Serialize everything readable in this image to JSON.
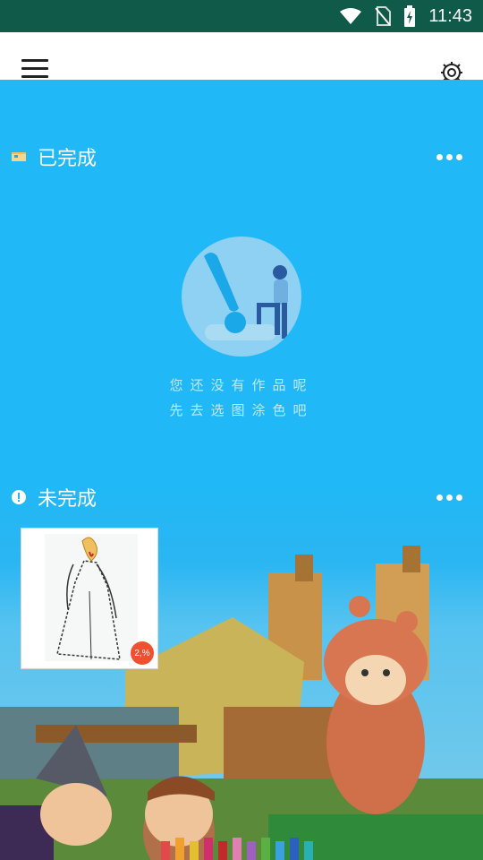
{
  "status_bar": {
    "time": "11:43",
    "icons": [
      "wifi-icon",
      "no-sim-icon",
      "battery-charging-icon"
    ]
  },
  "toolbar": {
    "left_icon": "menu-icon",
    "right_icon": "settings-icon"
  },
  "sections": {
    "completed": {
      "title": "已完成",
      "icon": "folder-icon",
      "more_icon": "more-horizontal-icon"
    },
    "incomplete": {
      "title": "未完成",
      "icon": "alert-circle-icon",
      "more_icon": "more-horizontal-icon"
    }
  },
  "empty_state": {
    "line1": "您还没有作品呢",
    "line2": "先去选图涂色吧"
  },
  "incomplete_items": [
    {
      "progress_label": "2,%"
    }
  ],
  "colors": {
    "status_bar": "#0f5a48",
    "content_bg": "#20b8f6",
    "badge": "#f05030"
  }
}
